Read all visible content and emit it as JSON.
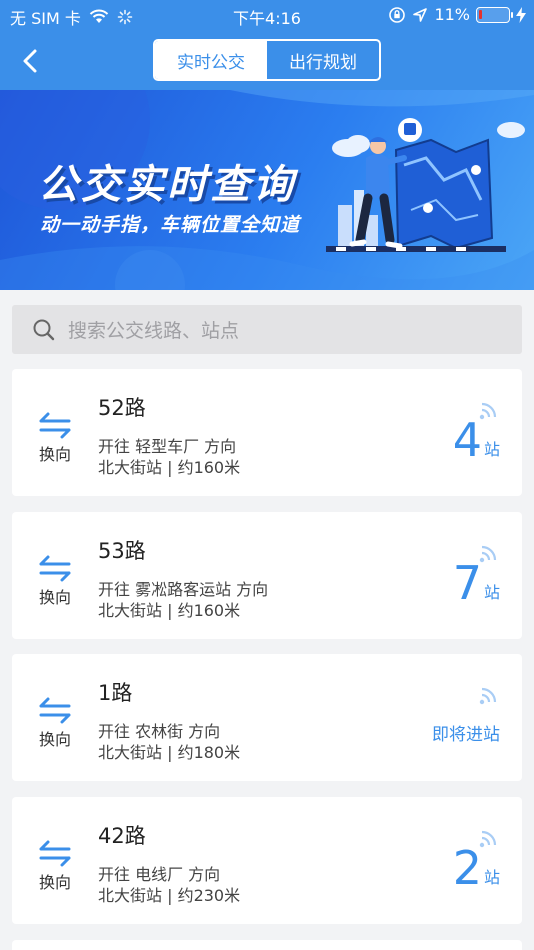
{
  "status_bar": {
    "carrier": "无 SIM 卡",
    "time": "下午4:16",
    "battery_percent": "11%",
    "battery_level": 0.11,
    "icons": [
      "wifi-icon",
      "loading-icon",
      "orientation-lock-icon",
      "location-icon",
      "battery-icon",
      "charging-icon"
    ]
  },
  "nav": {
    "tabs": [
      {
        "label": "实时公交",
        "active": true
      },
      {
        "label": "出行规划",
        "active": false
      }
    ]
  },
  "banner": {
    "title": "公交实时查询",
    "subtitle": "动一动手指，车辆位置全知道"
  },
  "search": {
    "placeholder": "搜索公交线路、站点"
  },
  "routes": [
    {
      "name": "52路",
      "direction": "开往 轻型车厂 方向",
      "stop": "北大街站 | 约160米",
      "eta_num": "4",
      "eta_unit": "站",
      "swap_label": "换向"
    },
    {
      "name": "53路",
      "direction": "开往 雾凇路客运站 方向",
      "stop": "北大街站 | 约160米",
      "eta_num": "7",
      "eta_unit": "站",
      "swap_label": "换向"
    },
    {
      "name": "1路",
      "direction": "开往 农林街 方向",
      "stop": "北大街站 | 约180米",
      "eta_text": "即将进站",
      "swap_label": "换向"
    },
    {
      "name": "42路",
      "direction": "开往 电线厂 方向",
      "stop": "北大街站 | 约230米",
      "eta_num": "2",
      "eta_unit": "站",
      "swap_label": "换向"
    }
  ],
  "colors": {
    "primary": "#3b8fe9",
    "battery_low": "#e5322d"
  }
}
